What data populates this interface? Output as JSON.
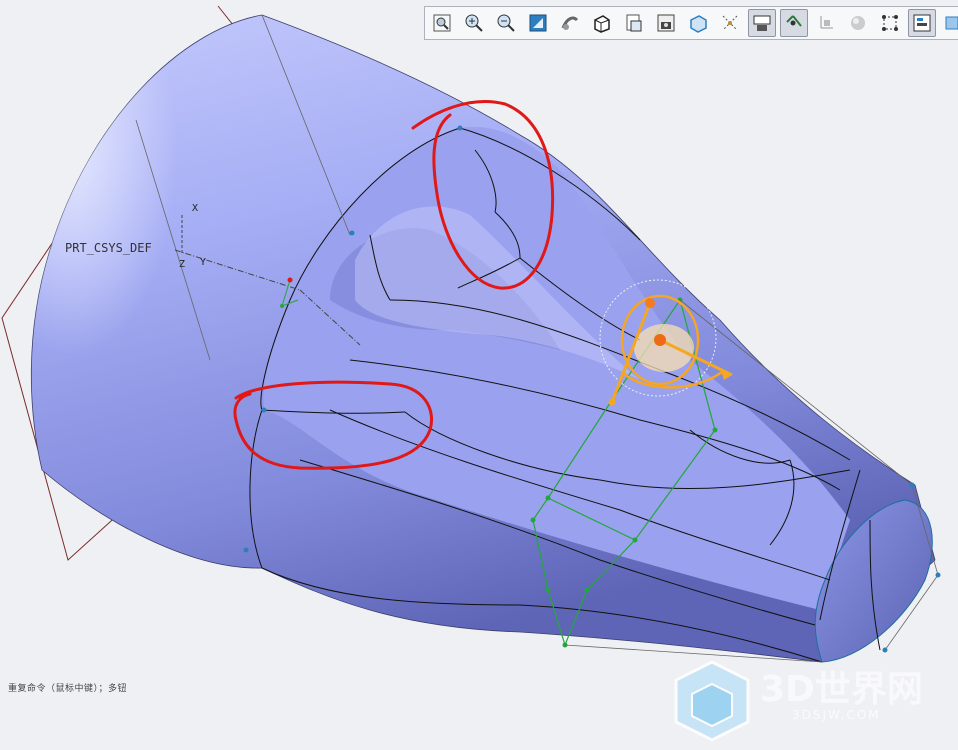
{
  "viewport": {
    "csys_label": "PRT_CSYS_DEF",
    "axis_labels": {
      "x": "X",
      "y": "Y",
      "z": "Z"
    }
  },
  "toolbar": {
    "buttons": [
      {
        "icon": "zoom-window-icon"
      },
      {
        "icon": "zoom-in-icon"
      },
      {
        "icon": "zoom-out-icon"
      },
      {
        "icon": "refit-icon"
      },
      {
        "icon": "repaint-icon"
      },
      {
        "icon": "display-style-icon"
      },
      {
        "icon": "saved-views-icon"
      },
      {
        "icon": "view-manager-icon"
      },
      {
        "icon": "perspective-view-icon"
      },
      {
        "icon": "datum-display-icon"
      },
      {
        "icon": "annotation-display-icon"
      },
      {
        "icon": "point-display-icon"
      },
      {
        "icon": "csys-display-icon"
      },
      {
        "icon": "spin-center-icon"
      },
      {
        "icon": "plane-display-icon"
      },
      {
        "icon": "model-tree-icon"
      },
      {
        "icon": "more-icon"
      }
    ],
    "active": [
      10,
      11,
      15
    ]
  },
  "status": {
    "message": "重复命令（鼠标中键）；多钮"
  },
  "watermark": {
    "text": "3D世界网",
    "url": "3DSJW.COM"
  },
  "colors": {
    "model_fill": "#a9b0f4",
    "model_dark": "#6f77c8",
    "highlight_red": "#e01818",
    "drag_handle": "#f5a623",
    "control_polygon": "#22a83a",
    "datum_plane": "#7a2a2a",
    "background": "#eff0f3"
  }
}
